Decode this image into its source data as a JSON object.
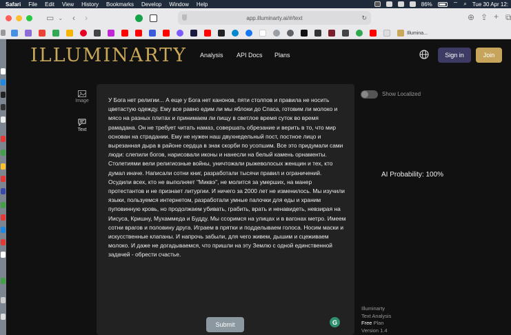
{
  "menubar": {
    "app": "Safari",
    "items": [
      "File",
      "Edit",
      "View",
      "History",
      "Bookmarks",
      "Develop",
      "Window",
      "Help"
    ],
    "battery": "86%",
    "datetime": "Tue 30 Apr  12:"
  },
  "browser": {
    "url": "app.illuminarty.ai/#/text",
    "bookmark_label": "Illumina..."
  },
  "header": {
    "logo": "ILLUMINARTY",
    "nav": [
      "Analysis",
      "API Docs",
      "Plans"
    ],
    "signin": "Sign in",
    "join": "Join"
  },
  "sidebar": {
    "items": [
      {
        "label": "Image"
      },
      {
        "label": "Text"
      }
    ]
  },
  "editor": {
    "text": "У Бога нет религии... А еще у Бога нет канонов, пяти столпов и правила не носить цветастую одежду. Ему все равно едим ли мы яблоки до Спаса, готовим ли молоко и мясо на разных плитах и принимаем ли пищу в светлое время суток во время рамадана. Он не требует читать намаз, совершать обрезание и верить в то, что мир основан на страдании. Ему не нужен наш двухнедельный пост, постное лицо и вырезанная дыра в районе сердца в знак скорби по усопшим. Все это придумали сами люди: слепили богов, нарисовали иконы и нанесли на белый камень орнаменты. Столетиями вели религиозные войны, уничтожали рыжеволосых женщин и тех, кто думал иначе. Написали сотни книг, разработали тысячи правил и ограничений. Осудили всех, кто не выполняет \"Миквэ\", не молится за умерших, на манер протестантов и не признает литургии. И ничего за 2000 лет не изменилось. Мы изучили языки, пользуемся интернетом, разработали умные палочки для еды и храним пуповинную кровь, но продолжаем убивать, грабить, врать и ненавидеть, невзирая на Иисуса, Кришну, Мухаммеда и Будду. Мы ссоримся на улицах и в вагонах метро. Имеем сотни врагов и половину друга. Играем в прятки и подделываем голоса. Носим маски и искусственные клапаны. И напрочь забыли, для чего живем, дышим и сцеживаем молоко. И даже не догадываемся, что пришли на эту Землю с одной единственной задачей - обрести счастье.",
    "submit": "Submit"
  },
  "panel": {
    "toggle_label": "Show Localized",
    "toggle_on": false,
    "probability": "AI Probability: 100%"
  },
  "footer": {
    "line1": "Illuminarty",
    "line2": "Text Analysis",
    "plan_free": "Free",
    "plan_word": "Plan",
    "version": "Version 1.4"
  },
  "colors": {
    "accent_gold": "#c7a45c",
    "signin_bg": "#3d3b63",
    "app_bg": "#111111",
    "editor_bg": "#222222"
  }
}
